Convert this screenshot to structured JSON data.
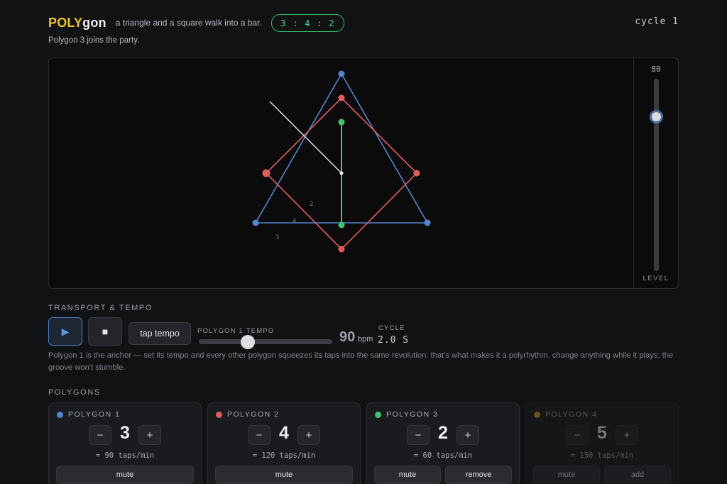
{
  "header": {
    "logo_highlight": "POLY",
    "logo_rest": "gon",
    "tagline": "a triangle and a square walk into a bar.",
    "ratio_badge": "3 : 4 : 2",
    "cycle_label": "cycle 1",
    "status": "Polygon 3 joins the party."
  },
  "stage": {
    "labels": [
      "2",
      "4",
      "3"
    ],
    "level": {
      "value": "80",
      "label": "LEVEL"
    },
    "colors": {
      "triangle": "#4f86d1",
      "square": "#e25c5c",
      "line": "#3fc56b",
      "hand": "#e8e8e8"
    }
  },
  "transport": {
    "heading": "TRANSPORT & TEMPO",
    "play_icon": "▶",
    "stop_icon": "■",
    "tap_label": "tap tempo",
    "tempo_label": "POLYGON 1 TEMPO",
    "tempo_value": "90",
    "tempo_unit": "bpm",
    "cycle_label": "CYCLE",
    "cycle_value": "2.0 S",
    "note": "Polygon 1 is the anchor — set its tempo and every other polygon squeezes its taps into the same revolution. that's what makes it a polyrhythm. change anything while it plays; the groove won't stumble."
  },
  "polygons": {
    "heading": "POLYGONS",
    "cards": [
      {
        "title": "POLYGON 1",
        "color": "#4f86d1",
        "minus": "−",
        "value": "3",
        "plus": "+",
        "taps": "= 90 taps/min",
        "btn1": "mute"
      },
      {
        "title": "POLYGON 2",
        "color": "#e25c5c",
        "minus": "−",
        "value": "4",
        "plus": "+",
        "taps": "= 120 taps/min",
        "btn1": "mute"
      },
      {
        "title": "POLYGON 3",
        "color": "#3fc56b",
        "minus": "−",
        "value": "2",
        "plus": "+",
        "taps": "= 60 taps/min",
        "btn1": "mute",
        "btn2": "remove"
      },
      {
        "title": "POLYGON 4",
        "color": "#c9a21d",
        "minus": "−",
        "value": "5",
        "plus": "+",
        "taps": "= 150 taps/min",
        "btn1": "mute",
        "btn2": "add"
      }
    ]
  }
}
